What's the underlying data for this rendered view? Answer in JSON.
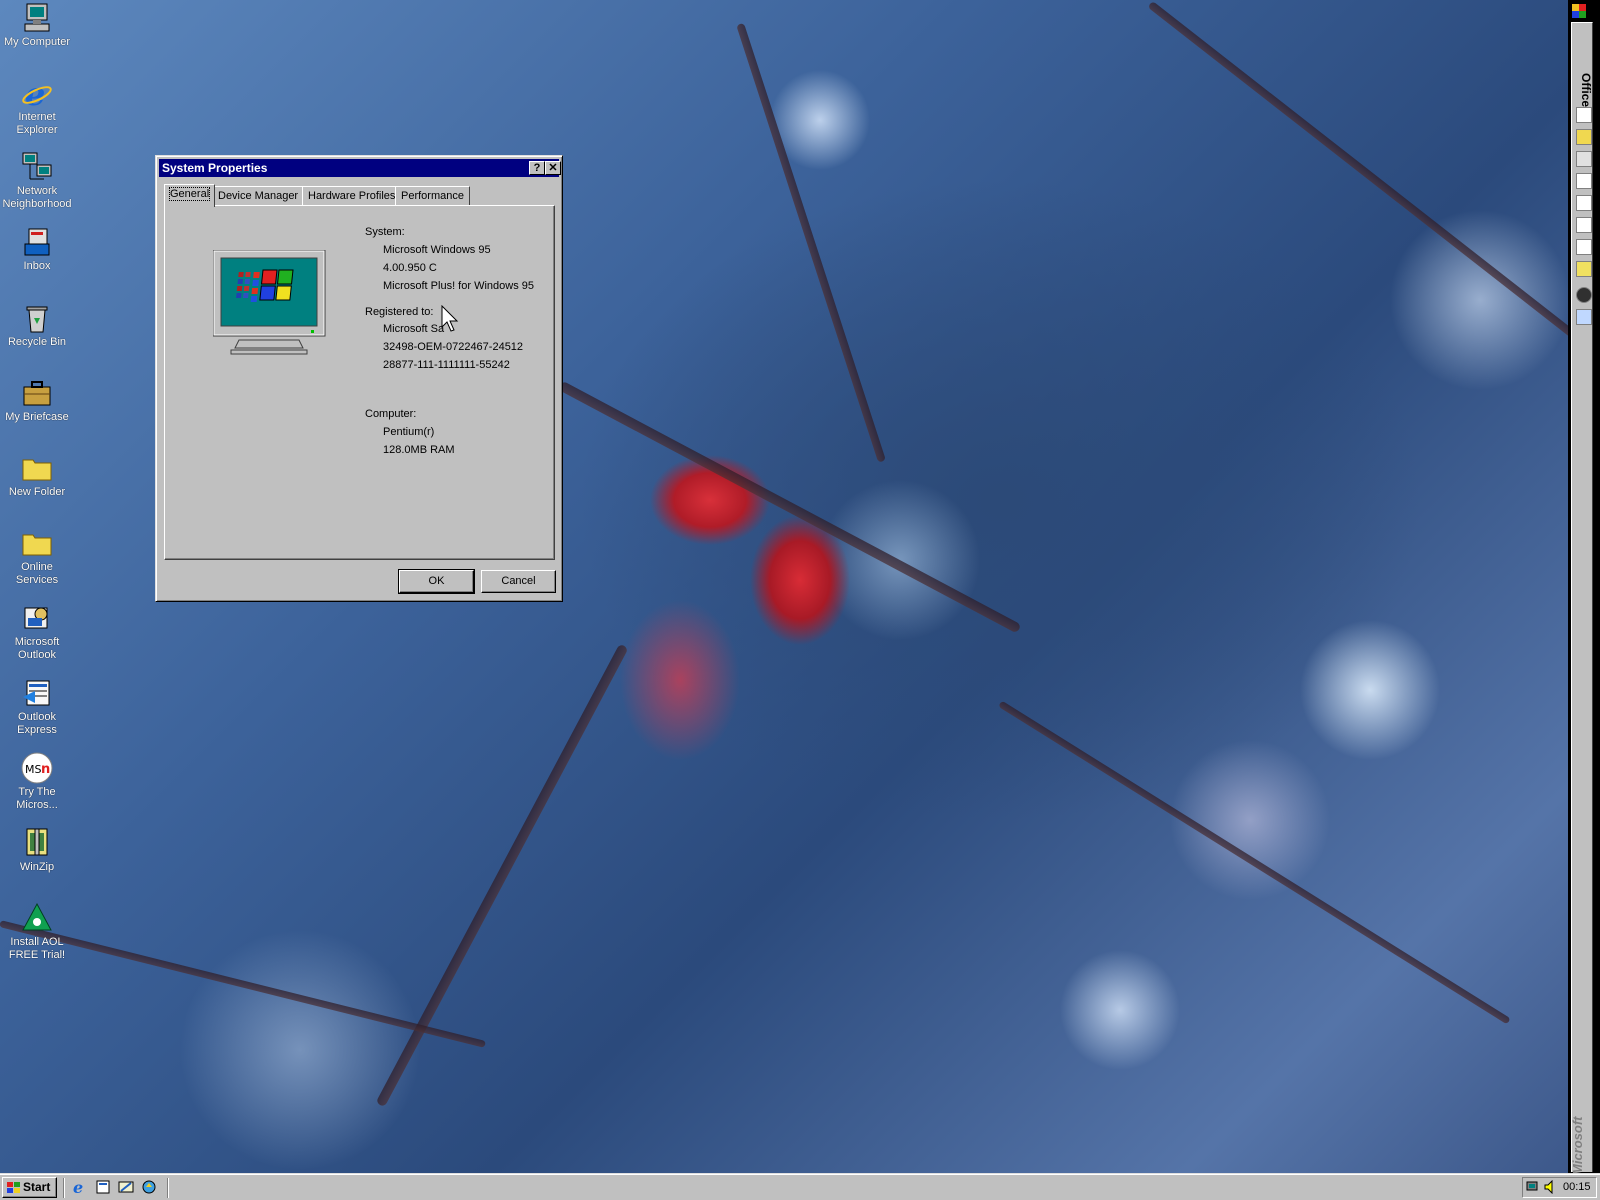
{
  "desktop": {
    "icons": [
      {
        "label": "My Computer",
        "icon": "my-computer-icon"
      },
      {
        "label": "Internet Explorer",
        "icon": "internet-explorer-icon"
      },
      {
        "label": "Network Neighborhood",
        "icon": "network-neighborhood-icon"
      },
      {
        "label": "Inbox",
        "icon": "inbox-icon"
      },
      {
        "label": "Recycle Bin",
        "icon": "recycle-bin-icon"
      },
      {
        "label": "My Briefcase",
        "icon": "briefcase-icon"
      },
      {
        "label": "New Folder",
        "icon": "folder-icon"
      },
      {
        "label": "Online Services",
        "icon": "folder-icon"
      },
      {
        "label": "Microsoft Outlook",
        "icon": "outlook-icon"
      },
      {
        "label": "Outlook Express",
        "icon": "outlook-express-icon"
      },
      {
        "label": "Try The Micros...",
        "icon": "msn-icon"
      },
      {
        "label": "WinZip",
        "icon": "winzip-icon"
      },
      {
        "label": "Install AOL FREE Trial!",
        "icon": "aol-icon"
      }
    ]
  },
  "office_bar": {
    "label": "Office",
    "brand": "Microsoft",
    "buttons": [
      "new-office-document",
      "open-office-document",
      "office-shortcut-3",
      "office-shortcut-4",
      "office-shortcut-5",
      "office-shortcut-6",
      "office-shortcut-7",
      "office-shortcut-8",
      "office-shortcut-9",
      "office-shortcut-10"
    ]
  },
  "dialog": {
    "title": "System Properties",
    "help_button": "?",
    "close_button": "✕",
    "tabs": [
      {
        "label": "General",
        "active": true
      },
      {
        "label": "Device Manager",
        "active": false
      },
      {
        "label": "Hardware Profiles",
        "active": false
      },
      {
        "label": "Performance",
        "active": false
      }
    ],
    "system": {
      "heading": "System:",
      "os": "Microsoft Windows 95",
      "version": "4.00.950 C",
      "plus": "Microsoft Plus! for Windows 95"
    },
    "registered": {
      "heading": "Registered to:",
      "name": "Microsoft Sa",
      "id1": "32498-OEM-0722467-24512",
      "id2": "28877-111-1111111-55242"
    },
    "computer": {
      "heading": "Computer:",
      "cpu": "Pentium(r)",
      "ram": "128.0MB RAM"
    },
    "ok_label": "OK",
    "cancel_label": "Cancel"
  },
  "taskbar": {
    "start_label": "Start",
    "quick_launch": [
      "internet-explorer-icon",
      "outlook-express-icon",
      "show-desktop-icon",
      "channels-icon"
    ],
    "clock": "00:15"
  },
  "colors": {
    "titlebar": "#000080",
    "face": "#c0c0c0"
  }
}
